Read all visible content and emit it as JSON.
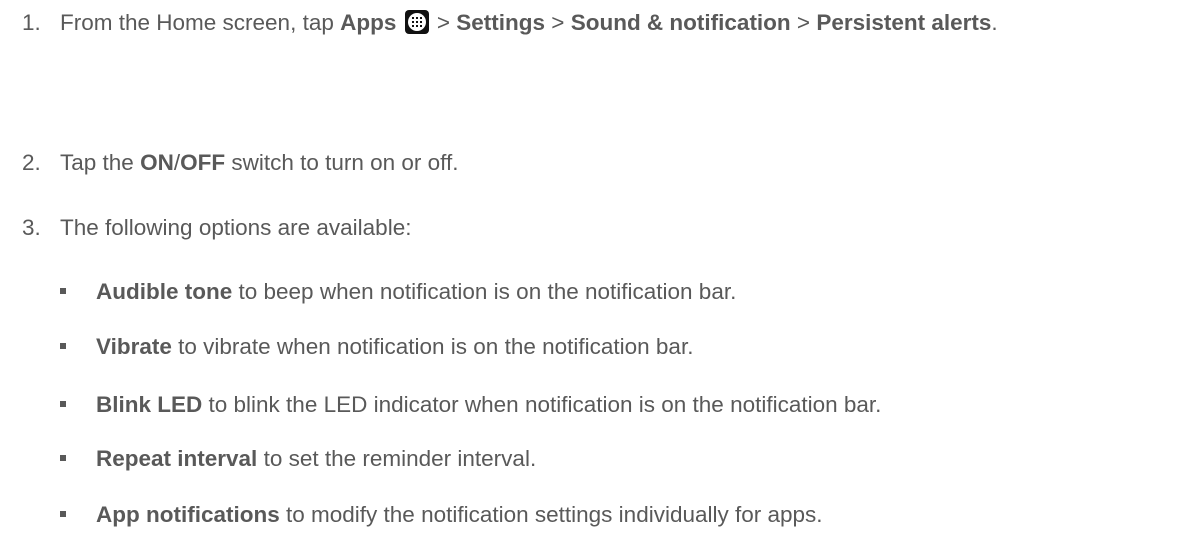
{
  "steps": [
    {
      "number": "1.",
      "parts": {
        "t1": "From the Home screen, tap ",
        "b1": "Apps",
        "t2": " > ",
        "b2": "Settings",
        "t3": " > ",
        "b3": "Sound & notification",
        "t4": " > ",
        "b4": "Persistent alerts",
        "t5": "."
      },
      "icon": "apps-grid-icon"
    },
    {
      "number": "2.",
      "parts": {
        "t1": "Tap the ",
        "b1": "ON",
        "t2": "/",
        "b2": "OFF",
        "t3": " switch to turn on or off."
      }
    },
    {
      "number": "3.",
      "text": "The following options are available:"
    }
  ],
  "options": [
    {
      "term": "Audible tone",
      "desc": " to beep when notification is on the notification bar."
    },
    {
      "term": "Vibrate",
      "desc": " to vibrate when notification is on the notification bar."
    },
    {
      "term": "Blink LED",
      "desc": " to blink the LED indicator when notification is on the notification bar."
    },
    {
      "term": "Repeat interval",
      "desc": " to set the reminder interval."
    },
    {
      "term": "App notifications",
      "desc": " to modify the notification settings individually for apps."
    }
  ],
  "colors": {
    "text": "#595959",
    "icon": "#111111"
  }
}
